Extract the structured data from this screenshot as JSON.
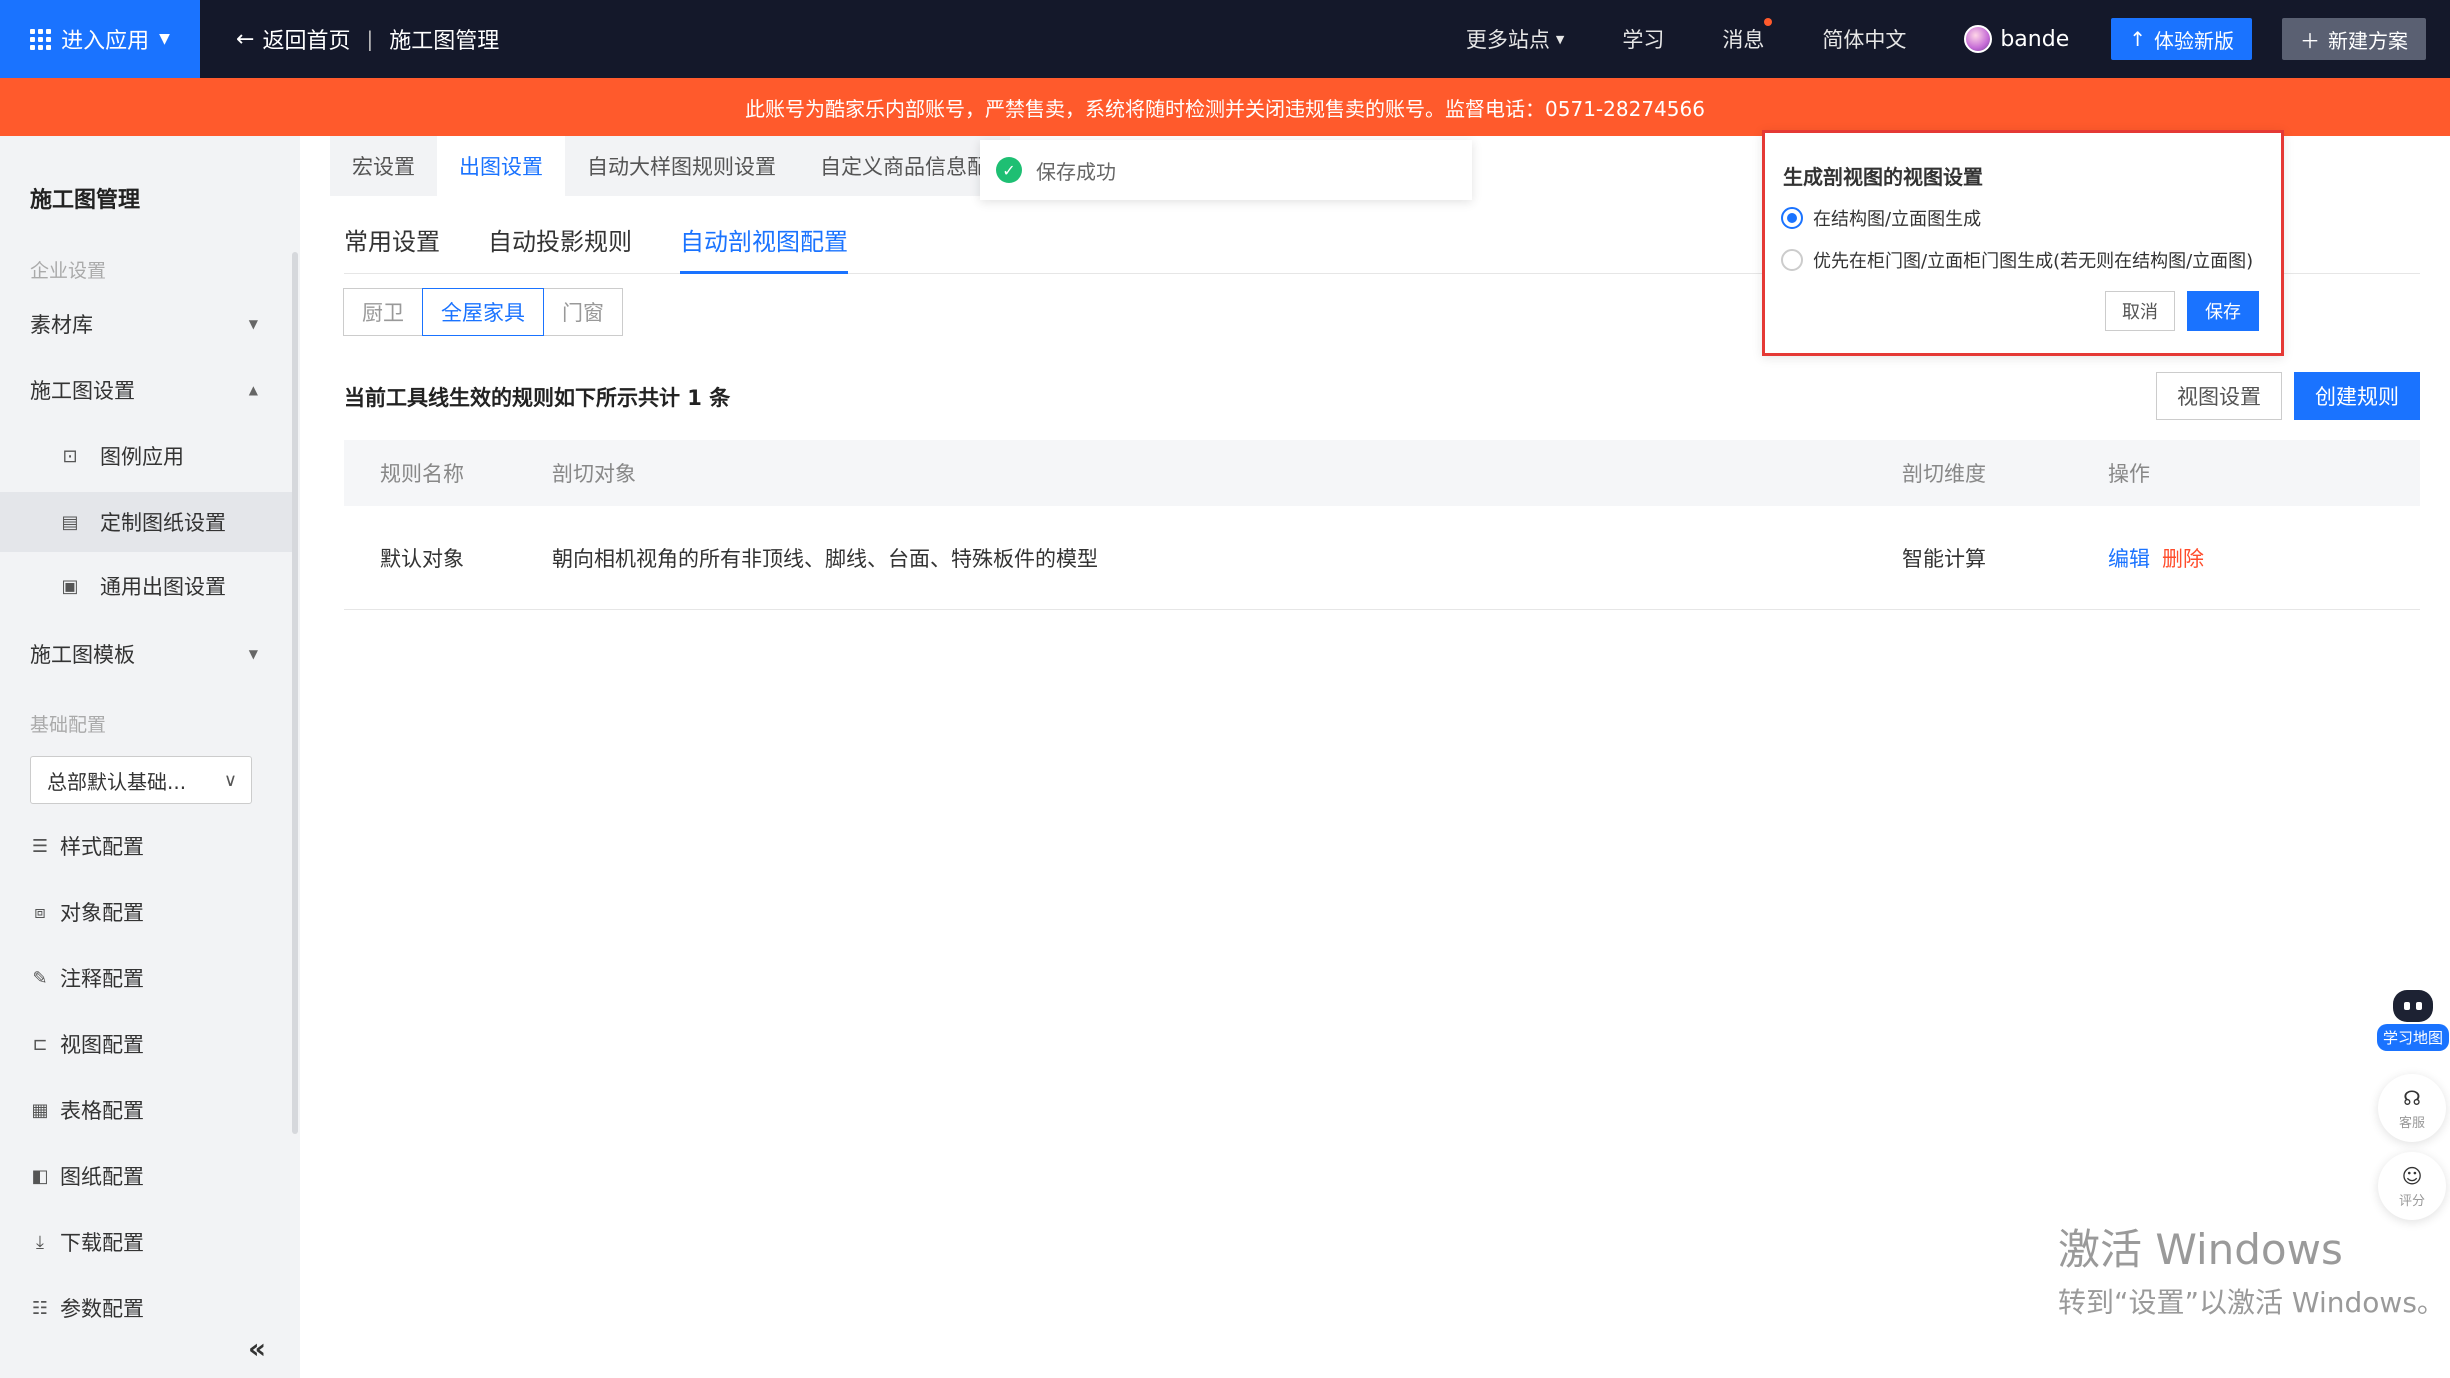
{
  "topbar": {
    "app_entry": "进入应用",
    "back_home": "返回首页",
    "crumb_sep": "|",
    "crumb_page": "施工图管理",
    "more_sites": "更多站点",
    "learn": "学习",
    "messages": "消息",
    "language": "简体中文",
    "username": "bande",
    "try_new": "体验新版",
    "new_plan": "新建方案"
  },
  "warning": "此账号为酷家乐内部账号，严禁售卖，系统将随时检测并关闭违规售卖的账号。监督电话：0571-28274566",
  "sidebar": {
    "title": "施工图管理",
    "section_enterprise": "企业设置",
    "material_lib": "素材库",
    "construction_settings": "施工图设置",
    "legend_apply": "图例应用",
    "custom_drawing": "定制图纸设置",
    "general_output": "通用出图设置",
    "template": "施工图模板",
    "section_basic": "基础配置",
    "basic_select": "总部默认基础...",
    "style_config": "样式配置",
    "object_config": "对象配置",
    "annotation_config": "注释配置",
    "view_config": "视图配置",
    "table_config": "表格配置",
    "drawing_config": "图纸配置",
    "download_config": "下载配置",
    "param_config": "参数配置",
    "collapse": "«"
  },
  "main_tabs": [
    {
      "label": "宏设置"
    },
    {
      "label": "出图设置"
    },
    {
      "label": "自动大样图规则设置"
    },
    {
      "label": "自定义商品信息配"
    }
  ],
  "toast": "保存成功",
  "sub_tabs": [
    {
      "label": "常用设置"
    },
    {
      "label": "自动投影规则"
    },
    {
      "label": "自动剖视图配置"
    }
  ],
  "segments": [
    {
      "label": "厨卫"
    },
    {
      "label": "全屋家具"
    },
    {
      "label": "门窗"
    }
  ],
  "summary": "当前工具线生效的规则如下所示共计 1 条",
  "view_settings_btn": "视图设置",
  "create_rule_btn": "创建规则",
  "table": {
    "headers": [
      "规则名称",
      "剖切对象",
      "剖切维度",
      "操作"
    ],
    "rows": [
      {
        "name": "默认对象",
        "target": "朝向相机视角的所有非顶线、脚线、台面、特殊板件的模型",
        "dimension": "智能计算",
        "edit": "编辑",
        "delete": "删除"
      }
    ]
  },
  "popover": {
    "title": "生成剖视图的视图设置",
    "option1": "在结构图/立面图生成",
    "option2": "优先在柜门图/立面柜门图生成(若无则在结构图/立面图)",
    "cancel": "取消",
    "save": "保存"
  },
  "float": {
    "learn_map": "学习地图",
    "service": "客服",
    "rate": "评分"
  },
  "watermark": {
    "line1": "激活 Windows",
    "line2": "转到“设置”以激活 Windows。"
  }
}
